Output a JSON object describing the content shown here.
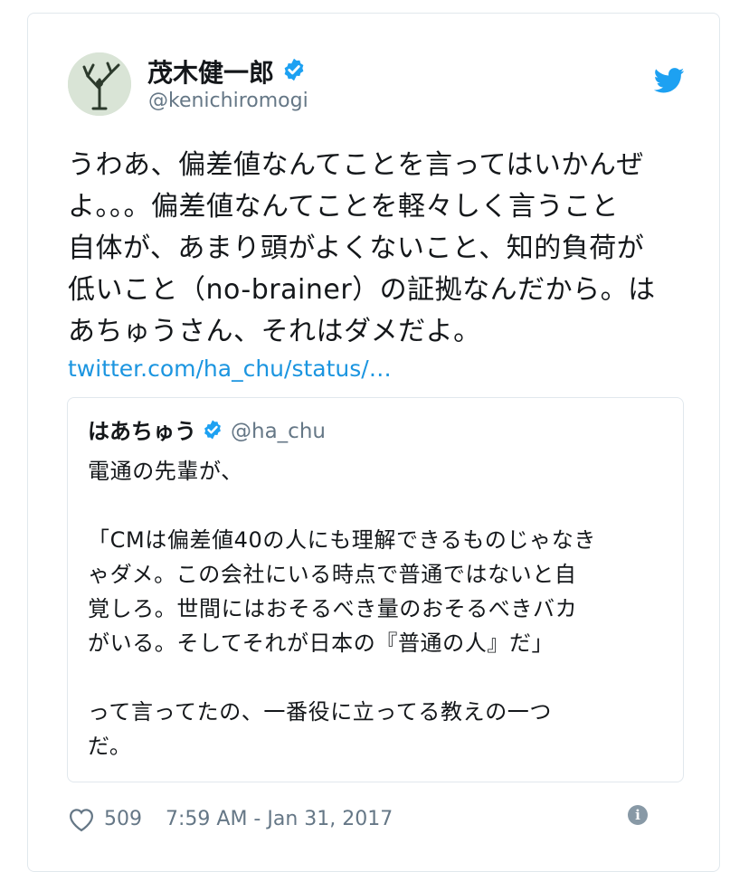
{
  "author": {
    "name": "茂木健一郎",
    "handle": "@kenichiromogi",
    "verified": true
  },
  "brand_icon": "twitter-bird-icon",
  "tweet": {
    "lines": [
      "うわあ、偏差値なんてことを言ってはいかんぜ",
      "よ。。。偏差値なんてことを軽々しく言うこと",
      "自体が、あまり頭がよくないこと、知的負荷が",
      "低いこと（no-brainer）の証拠なんだから。は",
      "あちゅうさん、それはダメだよ。"
    ],
    "link": "twitter.com/ha_chu/status/…"
  },
  "quoted_tweet": {
    "name": "はあちゅう",
    "handle": "@ha_chu",
    "verified": true,
    "lines": [
      "電通の先輩が、",
      "",
      "「CMは偏差値40の人にも理解できるものじゃなき",
      "ゃダメ。この会社にいる時点で普通ではないと自",
      "覚しろ。世間にはおそるべき量のおそるべきバカ",
      "がいる。そしてそれが日本の『普通の人』だ」",
      "",
      "って言ってたの、一番役に立ってる教えの一つ",
      "だ。"
    ]
  },
  "footer": {
    "like_count": "509",
    "timestamp": "7:59 AM - Jan 31, 2017",
    "info_icon": "info-icon"
  },
  "colors": {
    "link": "#1b95e0",
    "verified": "#1da1f2",
    "secondary_text": "#657786",
    "border": "#e1e8ed"
  }
}
